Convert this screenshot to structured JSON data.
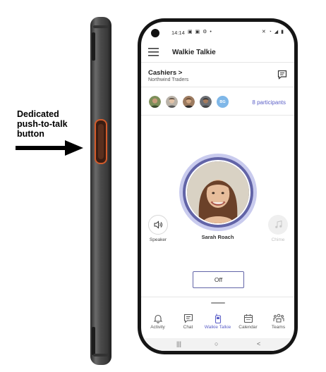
{
  "annotation": {
    "line1": "Dedicated",
    "line2": "push-to-talk",
    "line3": "button"
  },
  "status_bar": {
    "time": "14:14",
    "left_icons": "▣ ▣ ⚙ •",
    "right_icons": "✕ ◔ ◢ ▮"
  },
  "header": {
    "title": "Walkie Talkie",
    "menu_icon": "hamburger-icon"
  },
  "channel": {
    "name": "Cashiers >",
    "org": "Northwind Traders",
    "transcript_icon": "transcript-icon"
  },
  "participants": {
    "initials": "BG",
    "link": "8 participants"
  },
  "speaker": {
    "name": "Sarah Roach"
  },
  "controls": {
    "speaker_label": "Speaker",
    "chime_label": "Chime",
    "off_label": "Off"
  },
  "nav": [
    {
      "label": "Activity",
      "icon": "bell-icon"
    },
    {
      "label": "Chat",
      "icon": "chat-icon"
    },
    {
      "label": "Walkie Talkie",
      "icon": "walkie-talkie-icon"
    },
    {
      "label": "Calendar",
      "icon": "calendar-icon"
    },
    {
      "label": "Teams",
      "icon": "teams-icon"
    }
  ],
  "system_nav": {
    "recents": "|||",
    "home": "○",
    "back": "<"
  },
  "colors": {
    "accent": "#5b5fc7",
    "ring": "#6264a7",
    "ring_light": "#c9cbee",
    "ptt_button": "#d35b2b"
  }
}
